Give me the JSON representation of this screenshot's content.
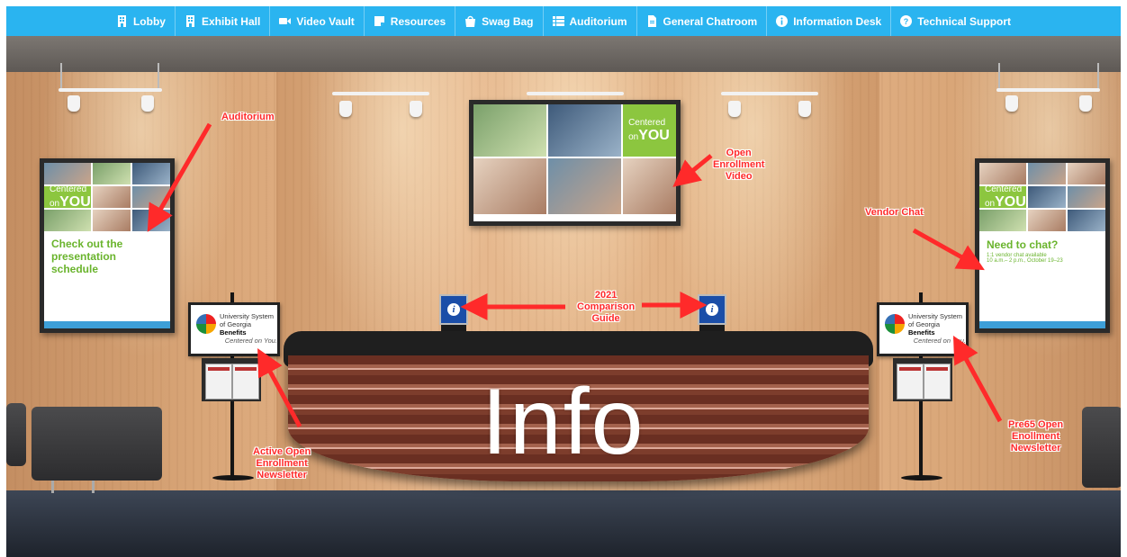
{
  "nav": {
    "items": [
      {
        "label": "Lobby",
        "icon": "building-icon"
      },
      {
        "label": "Exhibit Hall",
        "icon": "building-icon"
      },
      {
        "label": "Video Vault",
        "icon": "video-camera-icon"
      },
      {
        "label": "Resources",
        "icon": "note-icon"
      },
      {
        "label": "Swag Bag",
        "icon": "shopping-bag-icon"
      },
      {
        "label": "Auditorium",
        "icon": "list-icon"
      },
      {
        "label": "General Chatroom",
        "icon": "document-icon"
      },
      {
        "label": "Information Desk",
        "icon": "info-circle-icon"
      },
      {
        "label": "Technical Support",
        "icon": "question-circle-icon"
      }
    ],
    "color": "#2ab4f0"
  },
  "posters": {
    "left": {
      "tile_line1": "Centered",
      "tile_line2": "on",
      "tile_line3": "YOU",
      "cta": "Check out the presentation schedule"
    },
    "right": {
      "tile_line1": "Centered",
      "tile_line2": "on",
      "tile_line3": "YOU",
      "cta": "Need to chat?",
      "detail1": "1:1 vendor chat available",
      "detail2": "10 a.m.– 2 p.m., October 19–23"
    }
  },
  "tv": {
    "tile_line1": "Centered",
    "tile_line2": "on",
    "tile_line3": "YOU"
  },
  "kiosks": {
    "line1": "University System",
    "line2": "of Georgia",
    "line2_bold": "Benefits",
    "tagline": "Centered on You."
  },
  "info_sign": {
    "glyph": "i"
  },
  "desk": {
    "label": "Info"
  },
  "annotations": {
    "auditorium": "Auditorium",
    "video": [
      "Open",
      "Enrollment",
      "Video"
    ],
    "vendor_chat": "Vendor Chat",
    "guide": [
      "2021",
      "Comparison",
      "Guide"
    ],
    "active_newsletter": [
      "Active Open",
      "Enrollment",
      "Newsletter"
    ],
    "pre65_newsletter": [
      "Pre65 Open",
      "Enollment",
      "Newsletter"
    ],
    "color": "#ff2a2a"
  }
}
